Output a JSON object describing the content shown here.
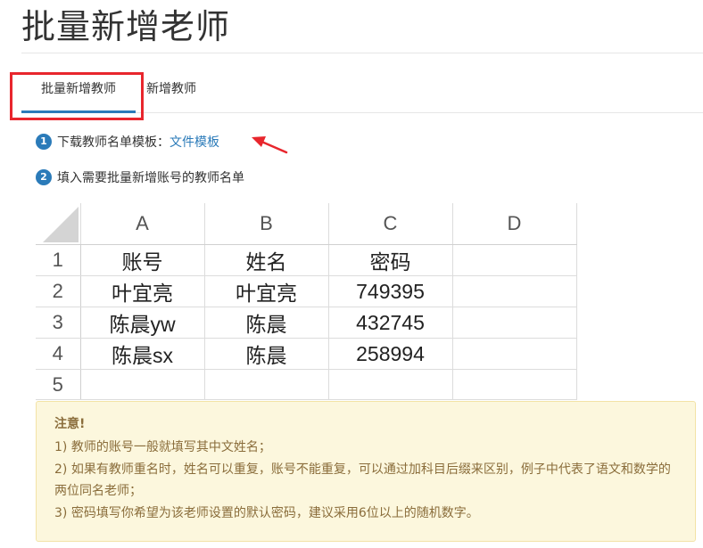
{
  "page": {
    "title": "批量新增老师"
  },
  "tabs": [
    {
      "label": "批量新增教师",
      "active": true
    },
    {
      "label": "新增教师",
      "active": false
    }
  ],
  "steps": [
    {
      "number": "1",
      "text": "下载教师名单模板：",
      "link_text": "文件模板"
    },
    {
      "number": "2",
      "text": "填入需要批量新增账号的教师名单"
    }
  ],
  "spreadsheet": {
    "column_headers": [
      "A",
      "B",
      "C",
      "D"
    ],
    "rows": [
      {
        "num": "1",
        "cells": [
          "账号",
          "姓名",
          "密码",
          ""
        ]
      },
      {
        "num": "2",
        "cells": [
          "叶宜亮",
          "叶宜亮",
          "749395",
          ""
        ]
      },
      {
        "num": "3",
        "cells": [
          "陈晨yw",
          "陈晨",
          "432745",
          ""
        ]
      },
      {
        "num": "4",
        "cells": [
          "陈晨sx",
          "陈晨",
          "258994",
          ""
        ]
      },
      {
        "num": "5",
        "cells": [
          "",
          "",
          "",
          ""
        ]
      }
    ]
  },
  "notice": {
    "title": "注意!",
    "lines": [
      "1) 教师的账号一般就填写其中文姓名；",
      "2) 如果有教师重名时，姓名可以重复，账号不能重复，可以通过加科目后缀来区别，例子中代表了语文和数学的两位同名老师；",
      "3) 密码填写你希望为该老师设置的默认密码，建议采用6位以上的随机数字。"
    ]
  },
  "colors": {
    "accent": "#2b7bb9",
    "annotation_red": "#e8262d",
    "notice_bg": "#fcf7dd",
    "notice_text": "#8a6d3b"
  },
  "icons": {
    "annotation_arrow": "red-arrow-icon"
  }
}
